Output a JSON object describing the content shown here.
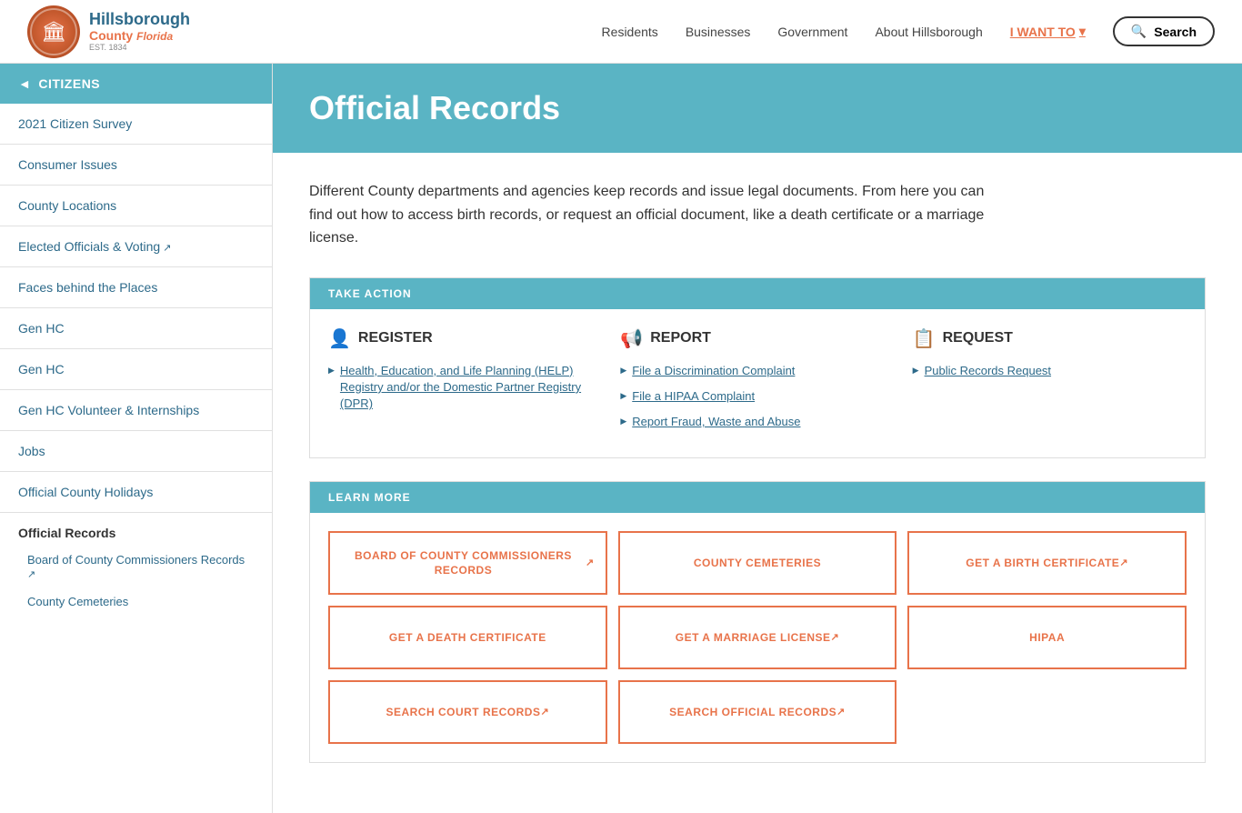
{
  "header": {
    "logo_title": "Hillsborough",
    "logo_subtitle": "County",
    "logo_region": "Florida",
    "logo_est": "EST. 1834",
    "nav": {
      "residents": "Residents",
      "businesses": "Businesses",
      "government": "Government",
      "about": "About Hillsborough",
      "iwantto": "I WANT TO",
      "search": "Search"
    }
  },
  "sidebar": {
    "citizens_label": "CITIZENS",
    "back_arrow": "◄",
    "menu_items": [
      {
        "label": "2021 Citizen Survey",
        "external": false
      },
      {
        "label": "Consumer Issues",
        "external": false
      },
      {
        "label": "County Locations",
        "external": false
      },
      {
        "label": "Elected Officials & Voting",
        "external": true
      },
      {
        "label": "Faces behind the Places",
        "external": false
      },
      {
        "label": "Gen HC",
        "external": false
      },
      {
        "label": "Gen HC",
        "external": false
      },
      {
        "label": "Gen HC Volunteer & Internships",
        "external": false
      },
      {
        "label": "Jobs",
        "external": false
      },
      {
        "label": "Official County Holidays",
        "external": false
      }
    ],
    "section_header": "Official Records",
    "subsection_items": [
      {
        "label": "Board of County Commissioners Records",
        "external": true
      },
      {
        "label": "County Cemeteries",
        "external": false
      }
    ]
  },
  "content": {
    "page_title": "Official Records",
    "description": "Different County departments and agencies keep records and issue legal documents. From here you can find out how to access birth records, or request an official document, like a death certificate or a marriage license.",
    "take_action_header": "TAKE ACTION",
    "action_columns": [
      {
        "icon": "👤",
        "title": "REGISTER",
        "links": [
          {
            "label": "Health, Education, and Life Planning (HELP) Registry and/or the Domestic Partner Registry (DPR)",
            "url": "#"
          }
        ]
      },
      {
        "icon": "📢",
        "title": "REPORT",
        "links": [
          {
            "label": "File a Discrimination Complaint",
            "url": "#"
          },
          {
            "label": "File a HIPAA Complaint",
            "url": "#"
          },
          {
            "label": "Report Fraud, Waste and Abuse",
            "url": "#"
          }
        ]
      },
      {
        "icon": "📋",
        "title": "REQUEST",
        "links": [
          {
            "label": "Public Records Request",
            "url": "#"
          }
        ]
      }
    ],
    "learn_more_header": "LEARN MORE",
    "learn_more_buttons": [
      {
        "label": "BOARD OF COUNTY COMMISSIONERS RECORDS",
        "external": true
      },
      {
        "label": "COUNTY CEMETERIES",
        "external": false
      },
      {
        "label": "GET A BIRTH CERTIFICATE",
        "external": true
      },
      {
        "label": "GET A DEATH CERTIFICATE",
        "external": false
      },
      {
        "label": "GET A MARRIAGE LICENSE",
        "external": true
      },
      {
        "label": "HIPAA",
        "external": false
      },
      {
        "label": "SEARCH COURT RECORDS",
        "external": true
      },
      {
        "label": "SEARCH OFFICIAL RECORDS",
        "external": true
      },
      {
        "label": "",
        "external": false
      }
    ]
  }
}
